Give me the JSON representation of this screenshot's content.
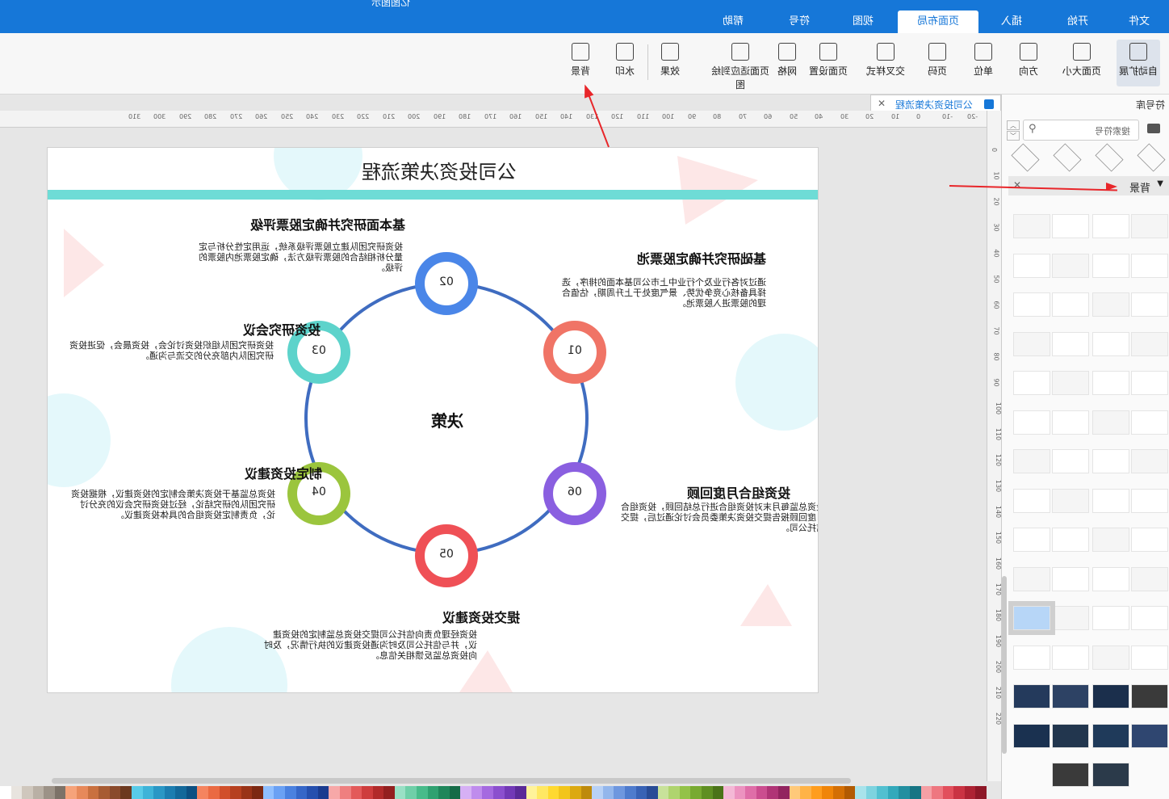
{
  "window": {
    "title": "亿图图示"
  },
  "tabs": [
    "文件",
    "开始",
    "插入",
    "页面布局",
    "视图",
    "符号",
    "帮助"
  ],
  "active_tab": "页面布局",
  "ribbon": [
    "自动扩展",
    "页面大小",
    "方向",
    "单位",
    "页码",
    "交叉样式",
    "页面设置",
    "网格",
    "页面适应到绘图",
    "效果",
    "水印",
    "背景"
  ],
  "doc_tab": {
    "label": "公司投资决策流程"
  },
  "ruler_h": [
    "-20",
    "-10",
    "0",
    "10",
    "20",
    "30",
    "40",
    "50",
    "60",
    "70",
    "80",
    "90",
    "100",
    "110",
    "120",
    "130",
    "140",
    "150",
    "160",
    "170",
    "180",
    "190",
    "200",
    "210",
    "220",
    "230",
    "240",
    "250",
    "260",
    "270",
    "280",
    "290",
    "300",
    "310"
  ],
  "ruler_v": [
    "0",
    "10",
    "20",
    "30",
    "40",
    "50",
    "60",
    "70",
    "80",
    "90",
    "100",
    "110",
    "120",
    "130",
    "140",
    "150",
    "160",
    "170",
    "180",
    "190",
    "200",
    "210",
    "220"
  ],
  "canvas": {
    "title": "公司投资决策流程",
    "center": "决策",
    "steps": [
      {
        "num": "01",
        "title": "基础研究并确定股票池",
        "desc": "通过对各行业及个行业中上市公司基本面的排序，选择具备核心竞争优势、景气度处于上升周期，估值合理的股票进入股票池。",
        "color": "#f07466"
      },
      {
        "num": "02",
        "title": "基本面研究并确定股票评级",
        "desc": "投资研究团队建立股票评级系统，运用定性分析与定量分析相结合的股票评级方法，确定股票池内股票的评级。",
        "color": "#4a86e8"
      },
      {
        "num": "03",
        "title": "投资研究会议",
        "desc": "投资研究团队组织投资讨论会，投资晨会，促进投资研究团队内部充分的交流与沟通。",
        "color": "#5dd3cb"
      },
      {
        "num": "04",
        "title": "制定投资建议",
        "desc": "投资总监基于投资决策会制定的投资建议，根据投资研究团队的研究结论，经过投资研究会议的充分讨论，负责制定投资组合的具体投资建议。",
        "color": "#9bc53d"
      },
      {
        "num": "05",
        "title": "提交投资建议",
        "desc": "投资经理负责向信托公司提交投资总监制定的投资建议，并与信托公司及时沟通投资建议的执行情况，及时向投资总监反馈相关信息。",
        "color": "#ef5056"
      },
      {
        "num": "06",
        "title": "投资组合月度回顾",
        "desc": "投资总监每月末对投资组合进行总结回顾，投资组合月度回顾报告提交投资决策委员会讨论通过后，提交信托公司。",
        "color": "#8a5fe0"
      }
    ]
  },
  "panel": {
    "title": "符号库",
    "search_placeholder": "搜索符号",
    "section": "背景",
    "accent": "#b7d6f7"
  },
  "palette": [
    "#ffffff",
    "#e8e4df",
    "#cfc7bd",
    "#b9b0a5",
    "#9c9287",
    "#7c7268",
    "#f6a37a",
    "#e7895a",
    "#c9703f",
    "#a75b33",
    "#8a4a2b",
    "#6c391f",
    "#58cbe8",
    "#3eb3d8",
    "#2a97c5",
    "#1c7db0",
    "#13689a",
    "#0c5082",
    "#f5845f",
    "#ea6a42",
    "#d14f2a",
    "#b6401f",
    "#993317",
    "#7c2811",
    "#8fbfff",
    "#6aa1f4",
    "#4a81e0",
    "#3566c8",
    "#254fae",
    "#1a3b8f",
    "#f7a8a8",
    "#ef7f7f",
    "#e35a5a",
    "#ce3d3d",
    "#b12a2a",
    "#931f1f",
    "#99e0c5",
    "#6fcfa8",
    "#48bb8a",
    "#2fa170",
    "#1f865a",
    "#156b47",
    "#d6b0f5",
    "#bf8ced",
    "#a56ae0",
    "#8b4fce",
    "#7239b6",
    "#5a2a98",
    "#fff39a",
    "#ffe863",
    "#ffd930",
    "#f2c51b",
    "#dca911",
    "#be8a0b",
    "#b8d1f6",
    "#93b6ec",
    "#6e97df",
    "#4e7bcd",
    "#3862b5",
    "#284b96",
    "#c8e29a",
    "#afd46e",
    "#93c248",
    "#78aa31",
    "#5f8f22",
    "#4a7318",
    "#f4b8d6",
    "#ec93c0",
    "#df6ea8",
    "#cb4d8f",
    "#b03476",
    "#92245f",
    "#ffc97a",
    "#ffb347",
    "#ff9d1e",
    "#f08509",
    "#d46f05",
    "#b25a03",
    "#a8e3eb",
    "#7dd3df",
    "#52c0d0",
    "#33a9bb",
    "#228fa0",
    "#167584",
    "#f5a0a5",
    "#ee7780",
    "#e24f5c",
    "#ca3343",
    "#ad2233",
    "#8e1727"
  ]
}
